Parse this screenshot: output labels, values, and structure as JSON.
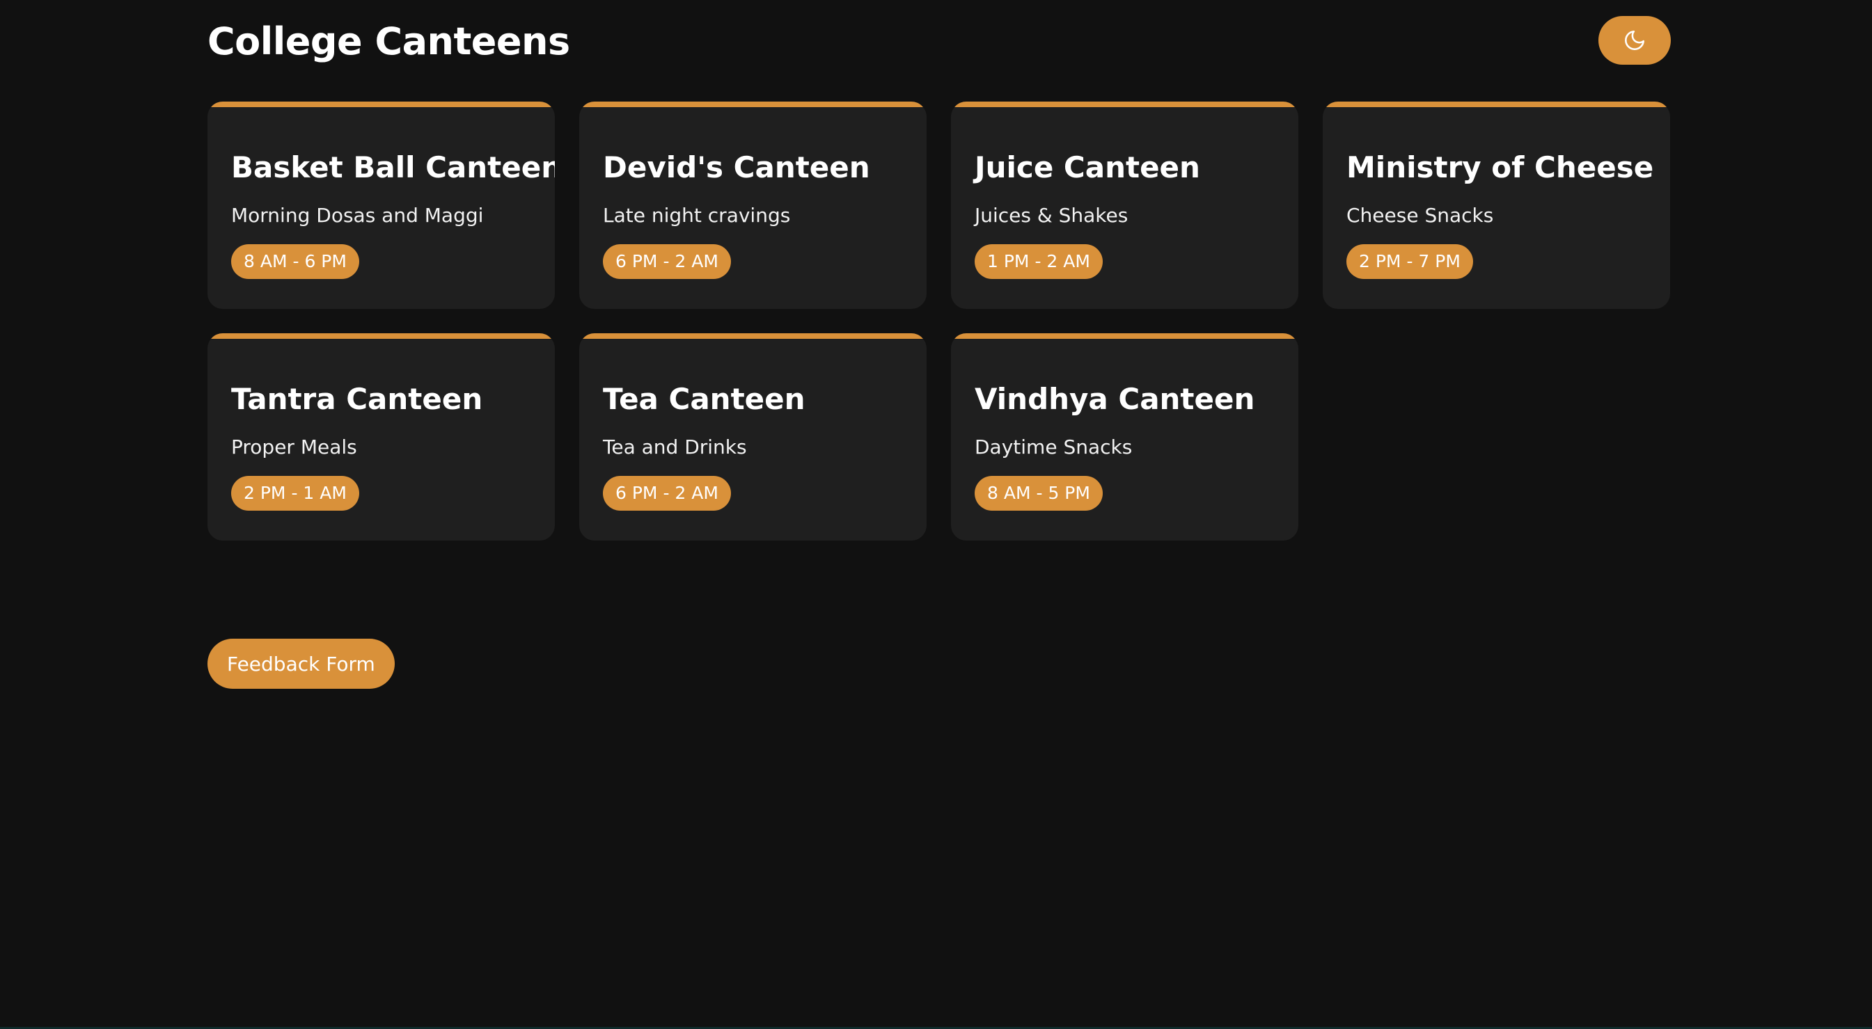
{
  "header": {
    "title": "College Canteens",
    "theme_toggle_icon": "moon-icon"
  },
  "canteens": [
    {
      "name": "Basket Ball Canteen",
      "description": "Morning Dosas and Maggi",
      "hours": "8 AM - 6 PM"
    },
    {
      "name": "Devid's Canteen",
      "description": "Late night cravings",
      "hours": "6 PM - 2 AM"
    },
    {
      "name": "Juice Canteen",
      "description": "Juices & Shakes",
      "hours": "1 PM - 2 AM"
    },
    {
      "name": "Ministry of Cheese",
      "description": "Cheese Snacks",
      "hours": "2 PM - 7 PM"
    },
    {
      "name": "Tantra Canteen",
      "description": "Proper Meals",
      "hours": "2 PM - 1 AM"
    },
    {
      "name": "Tea Canteen",
      "description": "Tea and Drinks",
      "hours": "6 PM - 2 AM"
    },
    {
      "name": "Vindhya Canteen",
      "description": "Daytime Snacks",
      "hours": "8 AM - 5 PM"
    }
  ],
  "feedback": {
    "label": "Feedback Form"
  },
  "colors": {
    "background": "#111111",
    "card": "#1f1f1f",
    "accent": "#d9913a",
    "text": "#ffffff"
  }
}
